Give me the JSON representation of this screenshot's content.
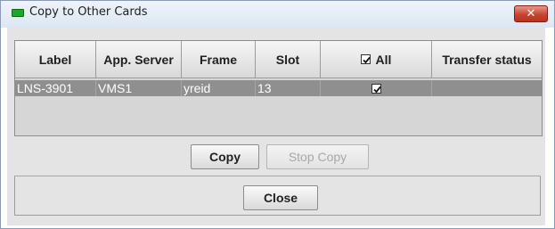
{
  "window": {
    "title": "Copy to Other Cards",
    "status_led_color": "#1ea82a",
    "close_icon": "close-x-icon"
  },
  "table": {
    "columns": [
      "Label",
      "App. Server",
      "Frame",
      "Slot",
      "All",
      "Transfer status"
    ],
    "all_checked": true,
    "rows": [
      {
        "label": "LNS-3901",
        "app_server": "VMS1",
        "frame": "yreid",
        "slot": "13",
        "selected": true,
        "transfer_status": ""
      }
    ]
  },
  "buttons": {
    "copy": "Copy",
    "stop_copy": "Stop Copy",
    "close": "Close"
  }
}
